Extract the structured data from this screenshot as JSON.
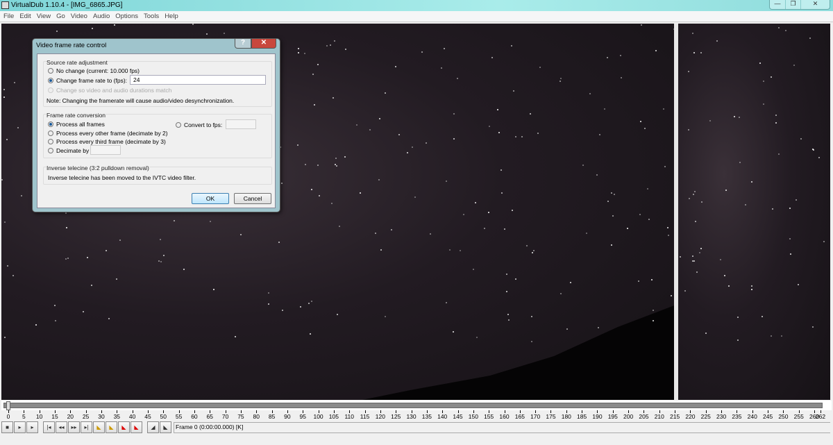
{
  "window": {
    "title": "VirtualDub 1.10.4 - [IMG_6865.JPG]",
    "controls": [
      "—",
      "❐",
      "✕"
    ]
  },
  "menu": [
    "File",
    "Edit",
    "View",
    "Go",
    "Video",
    "Audio",
    "Options",
    "Tools",
    "Help"
  ],
  "dialog": {
    "title": "Video frame rate control",
    "help": "?",
    "close": "✕",
    "source": {
      "label": "Source rate adjustment",
      "no_change": "No change (current: 10.000 fps)",
      "change_to": "Change frame rate to (fps):",
      "change_value": "24",
      "match": "Change so video and audio durations match",
      "note": "Note: Changing the framerate will cause audio/video desynchronization."
    },
    "conversion": {
      "label": "Frame rate conversion",
      "all": "Process all frames",
      "other": "Process every other frame (decimate by 2)",
      "third": "Process every third frame (decimate by 3)",
      "decimate": "Decimate by",
      "convert": "Convert to fps:",
      "decimate_value": "",
      "convert_value": ""
    },
    "ivtc": {
      "label": "Inverse telecine (3:2 pulldown removal)",
      "text": "Inverse telecine has been moved to the IVTC video filter."
    },
    "ok": "OK",
    "cancel": "Cancel"
  },
  "timeline": {
    "total_frames": 262,
    "current_frame": 0,
    "tick_step": 5,
    "end_label": "262"
  },
  "status": "Frame 0 (0:00:00.000) [K]"
}
